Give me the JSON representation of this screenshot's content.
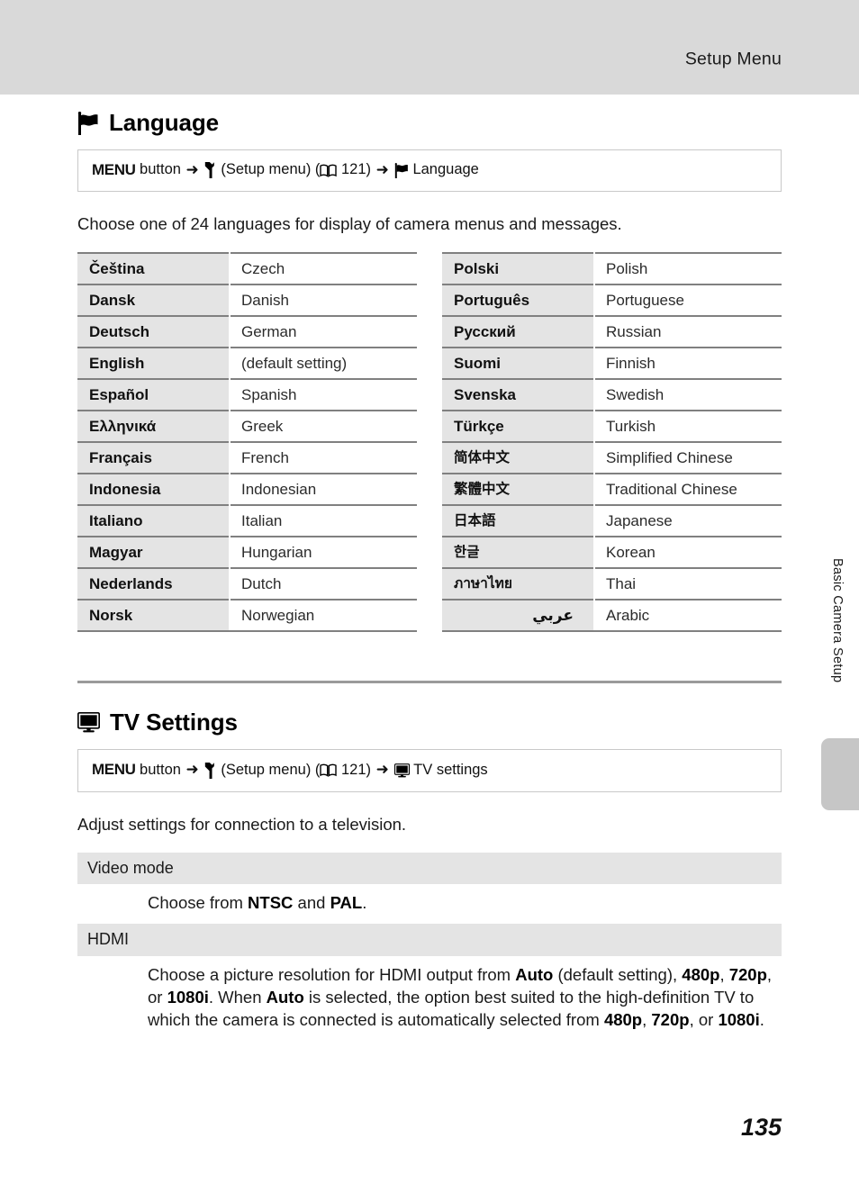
{
  "header": {
    "title": "Setup Menu"
  },
  "side_tab": {
    "label": "Basic Camera Setup"
  },
  "page": {
    "number": "135"
  },
  "language_section": {
    "icon": "flag-icon",
    "heading": "Language",
    "menu_path": {
      "menu_label": "MENU",
      "button_word": " button ",
      "arrow": "➜",
      "wrench_icon": "wrench-icon",
      "setup_menu_text": " (Setup menu) (",
      "book_icon": "book-icon",
      "page_ref": " 121) ",
      "target_icon": "flag-icon",
      "target_label": " Language"
    },
    "intro": "Choose one of 24 languages for display of camera menus and messages.",
    "left_column": [
      {
        "native": "Čeština",
        "english": "Czech"
      },
      {
        "native": "Dansk",
        "english": "Danish"
      },
      {
        "native": "Deutsch",
        "english": "German"
      },
      {
        "native": "English",
        "english": "(default setting)"
      },
      {
        "native": "Español",
        "english": "Spanish"
      },
      {
        "native": "Ελληνικά",
        "english": "Greek"
      },
      {
        "native": "Français",
        "english": "French"
      },
      {
        "native": "Indonesia",
        "english": "Indonesian"
      },
      {
        "native": "Italiano",
        "english": "Italian"
      },
      {
        "native": "Magyar",
        "english": "Hungarian"
      },
      {
        "native": "Nederlands",
        "english": "Dutch"
      },
      {
        "native": "Norsk",
        "english": "Norwegian"
      }
    ],
    "right_column": [
      {
        "native": "Polski",
        "english": "Polish"
      },
      {
        "native": "Português",
        "english": "Portuguese"
      },
      {
        "native": "Русский",
        "english": "Russian"
      },
      {
        "native": "Suomi",
        "english": "Finnish"
      },
      {
        "native": "Svenska",
        "english": "Swedish"
      },
      {
        "native": "Türkçe",
        "english": "Turkish"
      },
      {
        "native": "简体中文",
        "english": "Simplified Chinese"
      },
      {
        "native": "繁體中文",
        "english": "Traditional Chinese"
      },
      {
        "native": "日本語",
        "english": "Japanese"
      },
      {
        "native": "한글",
        "english": "Korean"
      },
      {
        "native": "ภาษาไทย",
        "english": "Thai"
      },
      {
        "native": "عربي",
        "english": "Arabic"
      }
    ]
  },
  "tv_section": {
    "icon": "tv-icon",
    "heading": "TV Settings",
    "menu_path": {
      "menu_label": "MENU",
      "button_word": " button ",
      "arrow": "➜",
      "wrench_icon": "wrench-icon",
      "setup_menu_text": " (Setup menu) (",
      "book_icon": "book-icon",
      "page_ref": " 121) ",
      "target_icon": "tv-icon",
      "target_label": " TV settings"
    },
    "intro": "Adjust settings for connection to a television.",
    "rows": [
      {
        "title": "Video mode",
        "body_parts": [
          {
            "text": "Choose from ",
            "bold": false
          },
          {
            "text": "NTSC",
            "bold": true
          },
          {
            "text": " and ",
            "bold": false
          },
          {
            "text": "PAL",
            "bold": true
          },
          {
            "text": ".",
            "bold": false
          }
        ]
      },
      {
        "title": "HDMI",
        "body_parts": [
          {
            "text": "Choose a picture resolution for HDMI output from ",
            "bold": false
          },
          {
            "text": "Auto",
            "bold": true
          },
          {
            "text": " (default setting), ",
            "bold": false
          },
          {
            "text": "480p",
            "bold": true
          },
          {
            "text": ", ",
            "bold": false
          },
          {
            "text": "720p",
            "bold": true
          },
          {
            "text": ", or ",
            "bold": false
          },
          {
            "text": "1080i",
            "bold": true
          },
          {
            "text": ". When ",
            "bold": false
          },
          {
            "text": "Auto",
            "bold": true
          },
          {
            "text": " is selected, the option best suited to the high-definition TV to which the camera is connected is automatically selected from ",
            "bold": false
          },
          {
            "text": "480p",
            "bold": true
          },
          {
            "text": ", ",
            "bold": false
          },
          {
            "text": "720p",
            "bold": true
          },
          {
            "text": ", or ",
            "bold": false
          },
          {
            "text": "1080i",
            "bold": true
          },
          {
            "text": ".",
            "bold": false
          }
        ]
      }
    ]
  },
  "colors": {
    "header_band": "#d9d9d9",
    "row_shade": "#e4e4e4",
    "rule": "#808080",
    "tab": "#c6c6c6"
  }
}
